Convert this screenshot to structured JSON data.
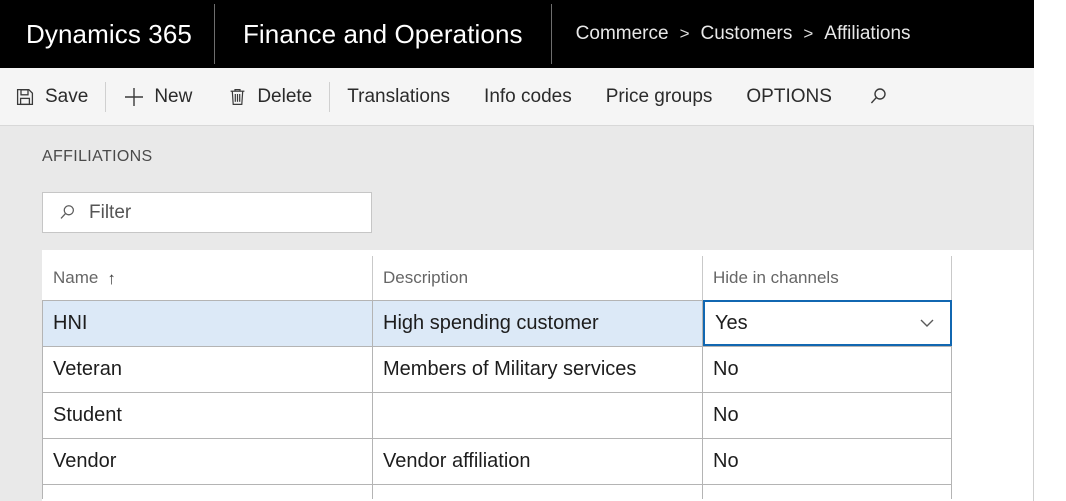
{
  "titlebar": {
    "brand": "Dynamics 365",
    "app": "Finance and Operations",
    "breadcrumb": [
      "Commerce",
      "Customers",
      "Affiliations"
    ],
    "breadcrumb_separator": ">",
    "background": "#000000",
    "text_color": "#ffffff"
  },
  "toolbar": {
    "items": [
      {
        "label": "Save",
        "icon": "save-icon"
      },
      {
        "label": "New",
        "icon": "plus-icon"
      },
      {
        "label": "Delete",
        "icon": "trash-icon"
      },
      {
        "label": "Translations",
        "icon": ""
      },
      {
        "label": "Info codes",
        "icon": ""
      },
      {
        "label": "Price groups",
        "icon": ""
      },
      {
        "label": "OPTIONS",
        "icon": ""
      }
    ],
    "search_icon": "search-icon",
    "background": "#f5f5f5"
  },
  "page": {
    "section_label": "AFFILIATIONS"
  },
  "filter": {
    "placeholder": "Filter",
    "value": "",
    "icon": "search-icon"
  },
  "grid": {
    "columns": [
      {
        "key": "name",
        "label": "Name",
        "sorted": true,
        "sort_direction": "ascending",
        "sort_glyph": "↑"
      },
      {
        "key": "description",
        "label": "Description",
        "sorted": false,
        "sort_glyph": ""
      },
      {
        "key": "hide_in_channels",
        "label": "Hide in channels",
        "sorted": false,
        "sort_glyph": ""
      }
    ],
    "rows": [
      {
        "name": "HNI",
        "description": "High spending customer",
        "hide_in_channels": "Yes",
        "selected": true,
        "editing_cell": "hide_in_channels"
      },
      {
        "name": "Veteran",
        "description": "Members of Military services",
        "hide_in_channels": "No",
        "selected": false,
        "editing_cell": ""
      },
      {
        "name": "Student",
        "description": "",
        "hide_in_channels": "No",
        "selected": false,
        "editing_cell": ""
      },
      {
        "name": "Vendor",
        "description": "Vendor affiliation",
        "hide_in_channels": "No",
        "selected": false,
        "editing_cell": ""
      }
    ],
    "selected_row_color": "#dce9f7",
    "focus_border_color": "#1167b1",
    "dropdown_options": [
      "Yes",
      "No"
    ]
  }
}
